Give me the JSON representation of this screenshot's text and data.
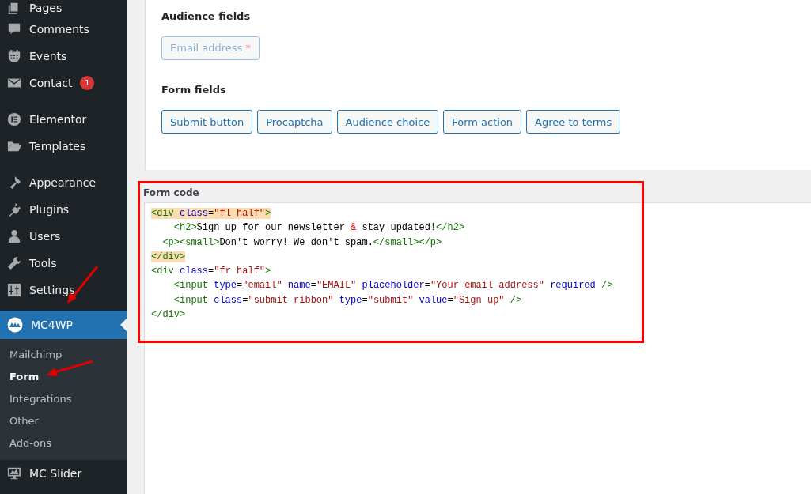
{
  "sidebar": {
    "groups": [
      [
        {
          "label": "Pages",
          "selected": false
        },
        {
          "label": "Comments",
          "selected": false
        },
        {
          "label": "Events",
          "selected": false
        },
        {
          "label": "Contact",
          "selected": false,
          "badge": "1"
        }
      ],
      [
        {
          "label": "Elementor",
          "selected": false
        },
        {
          "label": "Templates",
          "selected": false
        }
      ],
      [
        {
          "label": "Appearance",
          "selected": false
        },
        {
          "label": "Plugins",
          "selected": false
        },
        {
          "label": "Users",
          "selected": false
        },
        {
          "label": "Tools",
          "selected": false
        },
        {
          "label": "Settings",
          "selected": false
        }
      ],
      [
        {
          "label": "MC4WP",
          "selected": true,
          "children": [
            {
              "label": "Mailchimp",
              "selected": false
            },
            {
              "label": "Form",
              "selected": true
            },
            {
              "label": "Integrations",
              "selected": false
            },
            {
              "label": "Other",
              "selected": false
            },
            {
              "label": "Add-ons",
              "selected": false
            }
          ]
        },
        {
          "label": "MC Slider",
          "selected": false
        }
      ]
    ]
  },
  "audience_fields": {
    "heading": "Audience fields",
    "fields": [
      {
        "label": "Email address",
        "required_mark": "*"
      }
    ]
  },
  "form_fields": {
    "heading": "Form fields",
    "buttons": [
      "Submit button",
      "Procaptcha",
      "Audience choice",
      "Form action",
      "Agree to terms"
    ]
  },
  "form_code": {
    "label": "Form code",
    "lines": [
      {
        "highlighted": true,
        "tokens": [
          {
            "kind": "tag",
            "text": "<div "
          },
          {
            "kind": "attr",
            "text": "class"
          },
          {
            "kind": "text",
            "text": "="
          },
          {
            "kind": "string",
            "text": "\"fl half\""
          },
          {
            "kind": "tag",
            "text": ">"
          }
        ]
      },
      {
        "highlighted": false,
        "tokens": [
          {
            "kind": "tag",
            "text": "    <h2>"
          },
          {
            "kind": "text",
            "text": "Sign up for our newsletter "
          },
          {
            "kind": "amp",
            "text": "&"
          },
          {
            "kind": "text",
            "text": " stay updated!"
          },
          {
            "kind": "tag",
            "text": "</h2>"
          }
        ]
      },
      {
        "highlighted": false,
        "tokens": [
          {
            "kind": "tag",
            "text": "  <p><small>"
          },
          {
            "kind": "text",
            "text": "Don't worry! We don't spam."
          },
          {
            "kind": "tag",
            "text": "</small></p>"
          }
        ]
      },
      {
        "highlighted": true,
        "tokens": [
          {
            "kind": "tag",
            "text": "</div>"
          }
        ]
      },
      {
        "highlighted": false,
        "tokens": [
          {
            "kind": "tag",
            "text": "<div "
          },
          {
            "kind": "attr",
            "text": "class"
          },
          {
            "kind": "text",
            "text": "="
          },
          {
            "kind": "string",
            "text": "\"fr half\""
          },
          {
            "kind": "tag",
            "text": ">"
          }
        ]
      },
      {
        "highlighted": false,
        "tokens": [
          {
            "kind": "tag",
            "text": "    <input "
          },
          {
            "kind": "attr",
            "text": "type"
          },
          {
            "kind": "text",
            "text": "="
          },
          {
            "kind": "string",
            "text": "\"email\""
          },
          {
            "kind": "attr",
            "text": " name"
          },
          {
            "kind": "text",
            "text": "="
          },
          {
            "kind": "string",
            "text": "\"EMAIL\""
          },
          {
            "kind": "attr",
            "text": " placeholder"
          },
          {
            "kind": "text",
            "text": "="
          },
          {
            "kind": "string",
            "text": "\"Your email address\""
          },
          {
            "kind": "attr",
            "text": " required"
          },
          {
            "kind": "tag",
            "text": " />"
          }
        ]
      },
      {
        "highlighted": false,
        "tokens": [
          {
            "kind": "tag",
            "text": "    <input "
          },
          {
            "kind": "attr",
            "text": "class"
          },
          {
            "kind": "text",
            "text": "="
          },
          {
            "kind": "string",
            "text": "\"submit ribbon\""
          },
          {
            "kind": "attr",
            "text": " type"
          },
          {
            "kind": "text",
            "text": "="
          },
          {
            "kind": "string",
            "text": "\"submit\""
          },
          {
            "kind": "attr",
            "text": " value"
          },
          {
            "kind": "text",
            "text": "="
          },
          {
            "kind": "string",
            "text": "\"Sign up\""
          },
          {
            "kind": "tag",
            "text": " />"
          }
        ]
      },
      {
        "highlighted": false,
        "tokens": [
          {
            "kind": "tag",
            "text": "</div>"
          }
        ]
      }
    ]
  }
}
